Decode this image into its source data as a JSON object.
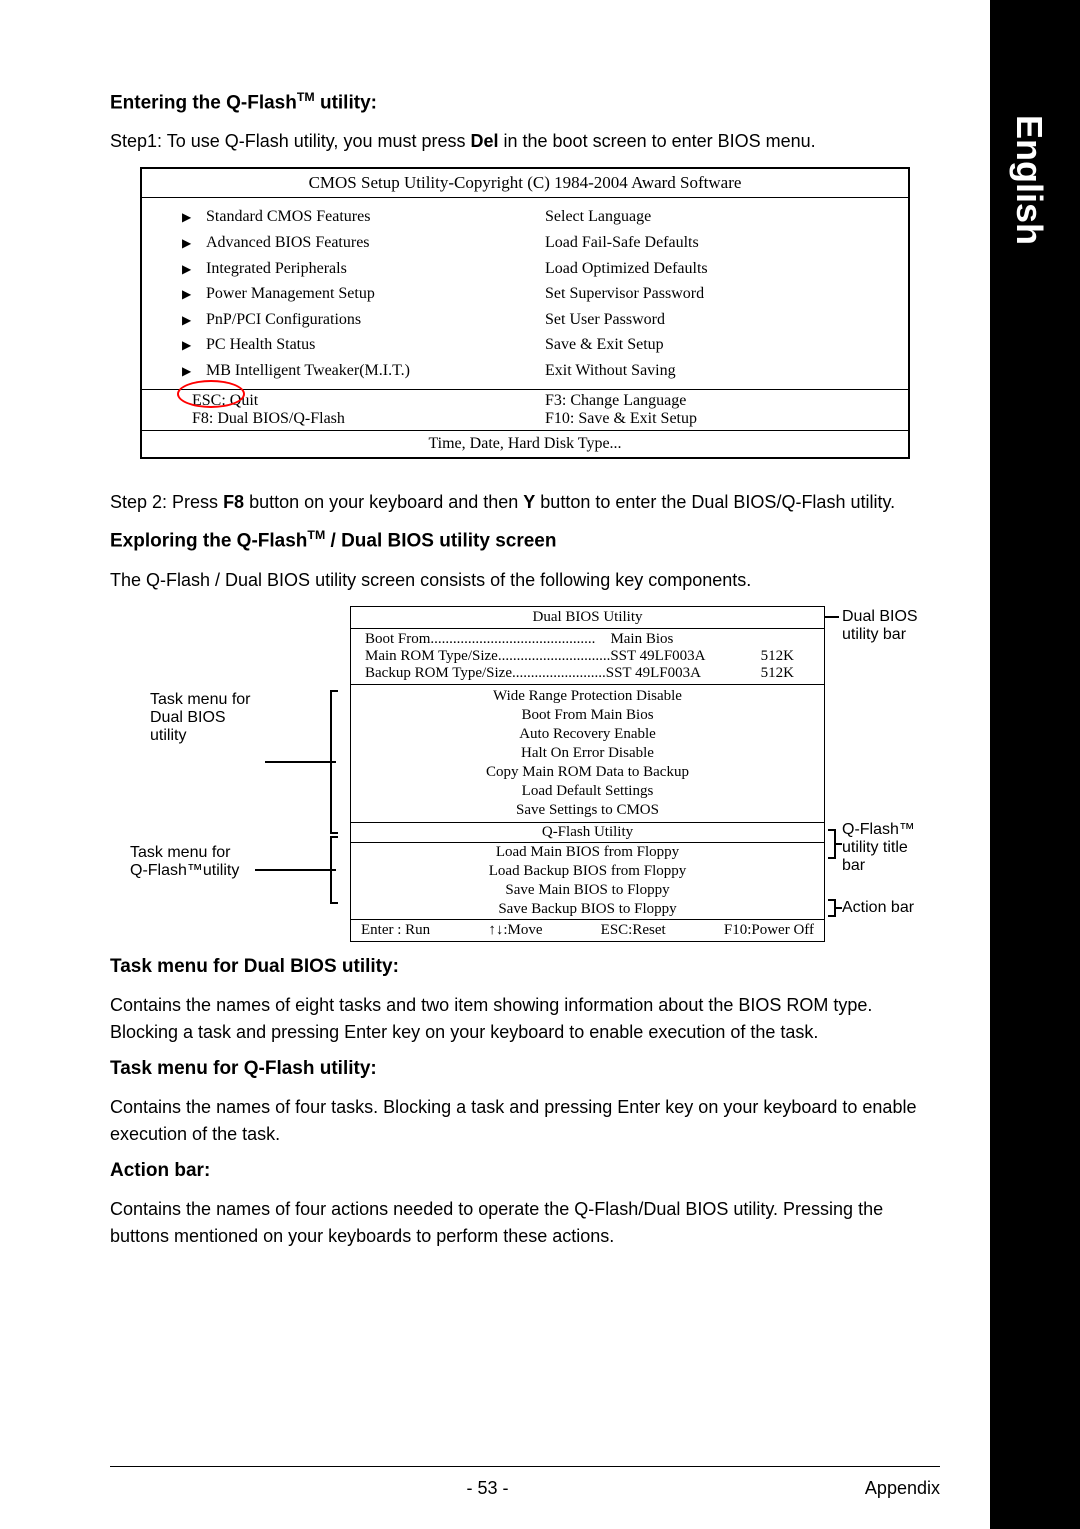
{
  "side_tab": "English",
  "h1": "Entering the Q-Flash™ utility:",
  "step1_pre": "Step1: To use Q-Flash utility, you must press ",
  "step1_bold": "Del",
  "step1_post": " in the boot screen to enter BIOS menu.",
  "bios": {
    "header": "CMOS Setup Utility-Copyright (C) 1984-2004 Award Software",
    "left": [
      "Standard CMOS Features",
      "Advanced BIOS Features",
      "Integrated Peripherals",
      "Power Management Setup",
      "PnP/PCI Configurations",
      "PC Health Status",
      "MB Intelligent Tweaker(M.I.T.)"
    ],
    "right": [
      "Select Language",
      "Load Fail-Safe Defaults",
      "Load Optimized Defaults",
      "Set Supervisor Password",
      "Set User Password",
      "Save & Exit Setup",
      "Exit Without Saving"
    ],
    "helpL1": "ESC: Quit",
    "helpL2": "F8: Dual BIOS/Q-Flash",
    "helpR1": "F3: Change Language",
    "helpR2": "F10: Save & Exit Setup",
    "footer": "Time, Date, Hard Disk Type..."
  },
  "step2_a": "Step 2: Press ",
  "step2_b": "F8",
  "step2_c": " button on your keyboard and then ",
  "step2_d": "Y",
  "step2_e": " button to enter the Dual BIOS/Q-Flash utility.",
  "h2": "Exploring the Q-Flash™ / Dual BIOS utility screen",
  "p2": "The Q-Flash / Dual BIOS utility screen consists of the following key components.",
  "dual": {
    "title": "Dual BIOS Utility",
    "boot_from_label": "Boot From............................................",
    "boot_from_val": "Main Bios",
    "main_rom_label": "Main ROM Type/Size..............................",
    "main_rom_val": "SST 49LF003A",
    "main_rom_size": "512K",
    "backup_rom_label": "Backup ROM Type/Size.........................",
    "backup_rom_val": "SST 49LF003A",
    "backup_rom_size": "512K",
    "task_rows": [
      "Wide Range Protection    Disable",
      "Boot From    Main Bios",
      "Auto Recovery    Enable",
      "Halt On Error    Disable",
      "Copy Main ROM Data to Backup",
      "Load Default Settings",
      "Save Settings to CMOS"
    ],
    "qflash_title": "Q-Flash Utility",
    "qflash_rows": [
      "Load Main BIOS from Floppy",
      "Load Backup BIOS from Floppy",
      "Save Main BIOS to Floppy",
      "Save Backup BIOS to Floppy"
    ],
    "actions": {
      "a": "Enter : Run",
      "b": "↑↓:Move",
      "c": "ESC:Reset",
      "d": "F10:Power Off"
    }
  },
  "callouts": {
    "a": "Dual BIOS utility bar",
    "b1": "Task menu for",
    "b2": "Dual BIOS",
    "b3": "utility",
    "c1": "Task menu for",
    "c2": "Q-Flash™utility",
    "d1": "Q-Flash™ utility title",
    "d2": "bar",
    "e": "Action bar"
  },
  "h3": "Task menu for Dual BIOS utility:",
  "p3": "Contains the names of eight tasks and two item showing information about the BIOS ROM type. Blocking a task and pressing Enter key on your keyboard to enable execution of the task.",
  "h4": "Task menu for Q-Flash utility:",
  "p4": "Contains the names of four tasks. Blocking a task and pressing Enter key on your keyboard to enable execution of the task.",
  "h5": "Action bar:",
  "p5": "Contains the names of four actions needed to operate the Q-Flash/Dual BIOS utility. Pressing the buttons mentioned on your keyboards to perform these actions.",
  "page_num": "- 53 -",
  "appendix": "Appendix"
}
